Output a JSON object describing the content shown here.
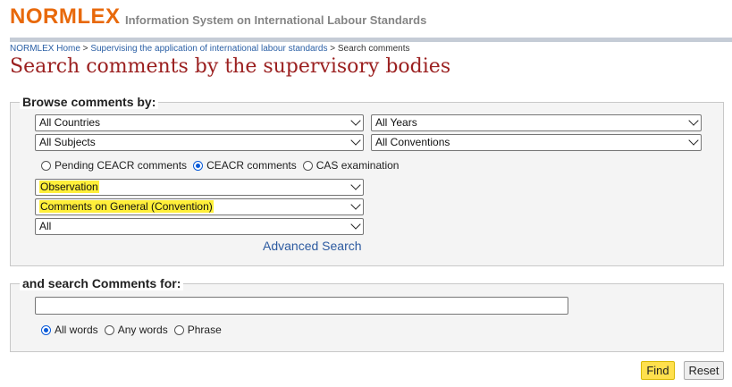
{
  "header": {
    "brand": "NORMLEX",
    "tagline": "Information System on International Labour Standards"
  },
  "breadcrumb": {
    "home": "NORMLEX Home",
    "sep1": " > ",
    "parent": "Supervising the application of international labour standards",
    "sep2": " > ",
    "current": "Search comments"
  },
  "page_title": "Search comments by the supervisory bodies",
  "browse": {
    "legend": "Browse comments by:",
    "countries": "All Countries",
    "years": "All Years",
    "subjects": "All Subjects",
    "conventions": "All Conventions",
    "radios": [
      {
        "label": "Pending CEACR comments",
        "checked": false
      },
      {
        "label": "CEACR comments",
        "checked": true
      },
      {
        "label": "CAS examination",
        "checked": false
      }
    ],
    "comment_type": "Observation",
    "comment_scope": "Comments on General (Convention)",
    "extra_filter": "All",
    "advanced_link": "Advanced Search"
  },
  "search": {
    "legend": "and search Comments for:",
    "value": "",
    "radios": [
      {
        "label": "All words",
        "checked": true
      },
      {
        "label": "Any words",
        "checked": false
      },
      {
        "label": "Phrase",
        "checked": false
      }
    ]
  },
  "actions": {
    "find_label": "Find",
    "reset_label": "Reset"
  },
  "colors": {
    "brand": "#e8690b",
    "title": "#9b2020",
    "highlight": "#ffef3a",
    "find_button": "#ffe04d",
    "link": "#2c5aa0"
  }
}
